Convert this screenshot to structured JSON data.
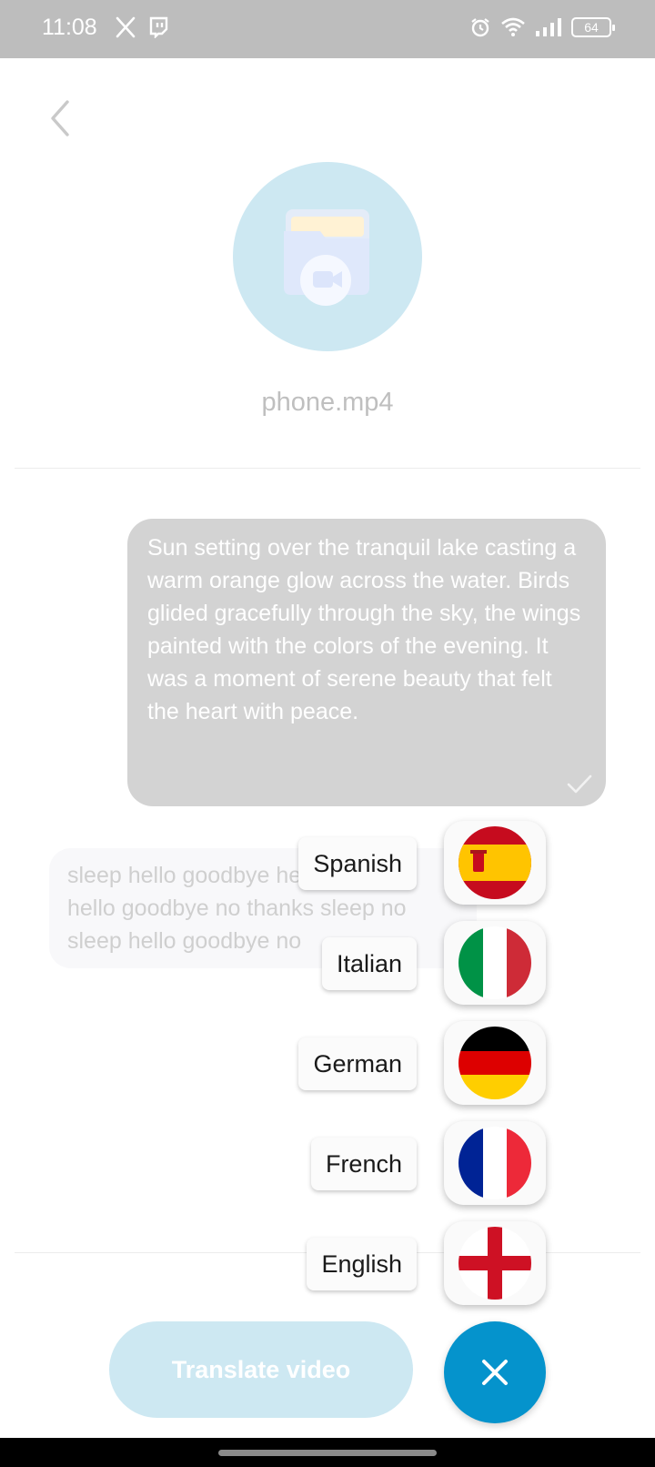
{
  "status_bar": {
    "time": "11:08",
    "left_icons": [
      "x-icon",
      "twitch-icon"
    ],
    "right_icons": [
      "alarm-icon",
      "wifi-icon",
      "signal-icon"
    ],
    "battery_level": "64"
  },
  "header": {
    "back_icon": "chevron-left-icon"
  },
  "file": {
    "icon": "video-folder-icon",
    "name": "phone.mp4"
  },
  "messages": {
    "main_text": "Sun setting over the tranquil lake casting a warm orange glow across the water. Birds glided gracefully through the sky, the wings painted with the colors of the evening. It was a moment of serene beauty that felt the heart with peace.",
    "main_status_icon": "check-icon",
    "secondary_text": "sleep hello goodbye hello goodbye hello goodbye no thanks sleep no sleep hello goodbye no"
  },
  "language_menu": {
    "items": [
      {
        "label": "Spanish",
        "flag": "spain-flag-icon"
      },
      {
        "label": "Italian",
        "flag": "italy-flag-icon"
      },
      {
        "label": "German",
        "flag": "germany-flag-icon"
      },
      {
        "label": "French",
        "flag": "france-flag-icon"
      },
      {
        "label": "English",
        "flag": "england-flag-icon"
      }
    ]
  },
  "actions": {
    "translate_label": "Translate video",
    "close_icon": "close-icon"
  },
  "colors": {
    "accent": "#0593cc",
    "accent_light": "#cde8f2",
    "status_bar": "#bdbdbd",
    "bubble_main": "#d3d3d3"
  }
}
